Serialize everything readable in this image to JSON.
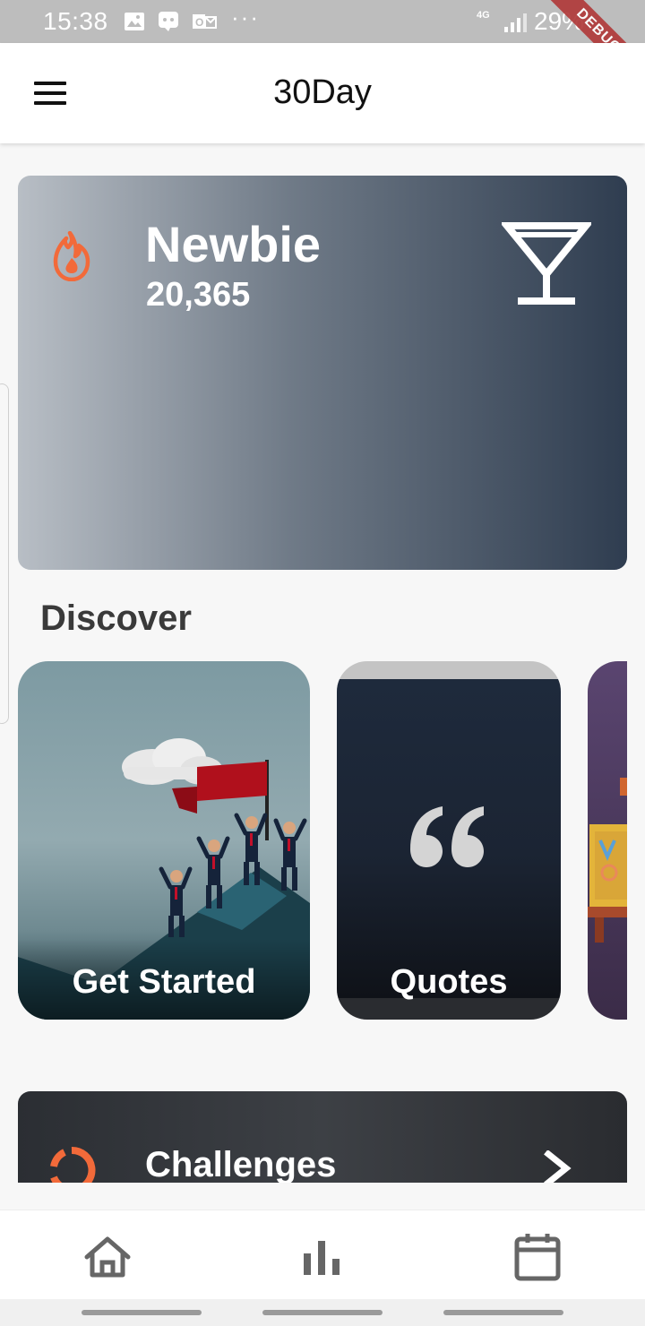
{
  "status_bar": {
    "time": "15:38",
    "more": "···",
    "network": "4G",
    "battery": "29%",
    "debug_banner": "DEBUG",
    "icons": [
      "image-icon",
      "chat-icon",
      "outlook-icon",
      "signal-icon",
      "battery-icon"
    ]
  },
  "app_bar": {
    "title": "30Day",
    "menu_icon": "hamburger-menu-icon"
  },
  "hero": {
    "rank": "Newbie",
    "points": "20,365",
    "left_icon": "flame-icon",
    "right_icon": "cocktail-icon",
    "accent_color": "#f26a3a"
  },
  "discover": {
    "title": "Discover",
    "cards": [
      {
        "label": "Get Started",
        "image": "people-climbing-mountain-with-flag"
      },
      {
        "label": "Quotes",
        "icon": "quote-mark-icon"
      },
      {
        "label": "",
        "image": "partially-visible-card"
      }
    ]
  },
  "challenges": {
    "label": "Challenges",
    "left_icon": "ring-icon",
    "right_icon": "chevron-right-icon"
  },
  "bottom_nav": {
    "items": [
      {
        "icon": "home-icon"
      },
      {
        "icon": "bar-chart-icon"
      },
      {
        "icon": "calendar-icon"
      }
    ]
  }
}
